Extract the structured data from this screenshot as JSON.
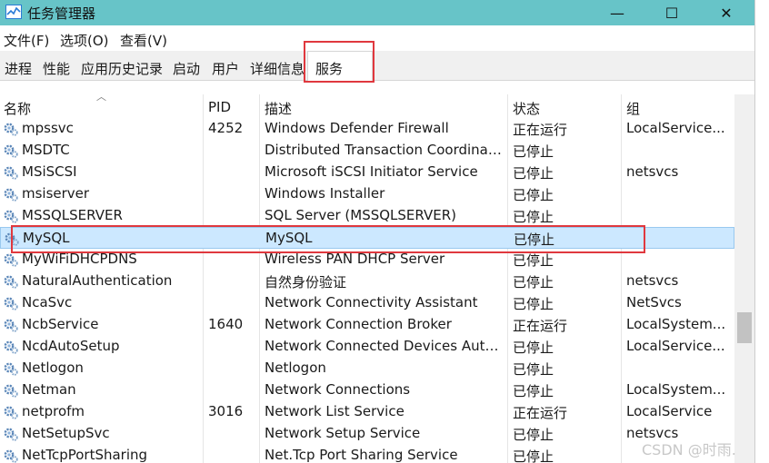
{
  "window": {
    "title": "任务管理器",
    "minimize": "—",
    "maximize": "☐",
    "close": "✕"
  },
  "menu": [
    "文件(F)",
    "选项(O)",
    "查看(V)"
  ],
  "tabs": [
    "进程",
    "性能",
    "应用历史记录",
    "启动",
    "用户",
    "详细信息",
    "服务"
  ],
  "active_tab": "服务",
  "columns": {
    "name": "名称",
    "pid": "PID",
    "description": "描述",
    "status": "状态",
    "group": "组"
  },
  "rows": [
    {
      "name": "mpssvc",
      "pid": "4252",
      "description": "Windows Defender Firewall",
      "status": "正在运行",
      "group": "LocalService..."
    },
    {
      "name": "MSDTC",
      "pid": "",
      "description": "Distributed Transaction Coordinat...",
      "status": "已停止",
      "group": ""
    },
    {
      "name": "MSiSCSI",
      "pid": "",
      "description": "Microsoft iSCSI Initiator Service",
      "status": "已停止",
      "group": "netsvcs"
    },
    {
      "name": "msiserver",
      "pid": "",
      "description": "Windows Installer",
      "status": "已停止",
      "group": ""
    },
    {
      "name": "MSSQLSERVER",
      "pid": "",
      "description": "SQL Server (MSSQLSERVER)",
      "status": "已停止",
      "group": ""
    },
    {
      "name": "MySQL",
      "pid": "",
      "description": "MySQL",
      "status": "已停止",
      "group": "",
      "selected": true
    },
    {
      "name": "MyWiFiDHCPDNS",
      "pid": "",
      "description": "Wireless PAN DHCP Server",
      "status": "已停止",
      "group": ""
    },
    {
      "name": "NaturalAuthentication",
      "pid": "",
      "description": "自然身份验证",
      "status": "已停止",
      "group": "netsvcs"
    },
    {
      "name": "NcaSvc",
      "pid": "",
      "description": "Network Connectivity Assistant",
      "status": "已停止",
      "group": "NetSvcs"
    },
    {
      "name": "NcbService",
      "pid": "1640",
      "description": "Network Connection Broker",
      "status": "正在运行",
      "group": "LocalSystem..."
    },
    {
      "name": "NcdAutoSetup",
      "pid": "",
      "description": "Network Connected Devices Auto...",
      "status": "已停止",
      "group": "LocalService..."
    },
    {
      "name": "Netlogon",
      "pid": "",
      "description": "Netlogon",
      "status": "已停止",
      "group": ""
    },
    {
      "name": "Netman",
      "pid": "",
      "description": "Network Connections",
      "status": "已停止",
      "group": "LocalSystem..."
    },
    {
      "name": "netprofm",
      "pid": "3016",
      "description": "Network List Service",
      "status": "正在运行",
      "group": "LocalService"
    },
    {
      "name": "NetSetupSvc",
      "pid": "",
      "description": "Network Setup Service",
      "status": "已停止",
      "group": "netsvcs"
    },
    {
      "name": "NetTcpPortSharing",
      "pid": "",
      "description": "Net.Tcp Port Sharing Service",
      "status": "已停止",
      "group": ""
    }
  ],
  "watermark": "CSDN @时雨."
}
